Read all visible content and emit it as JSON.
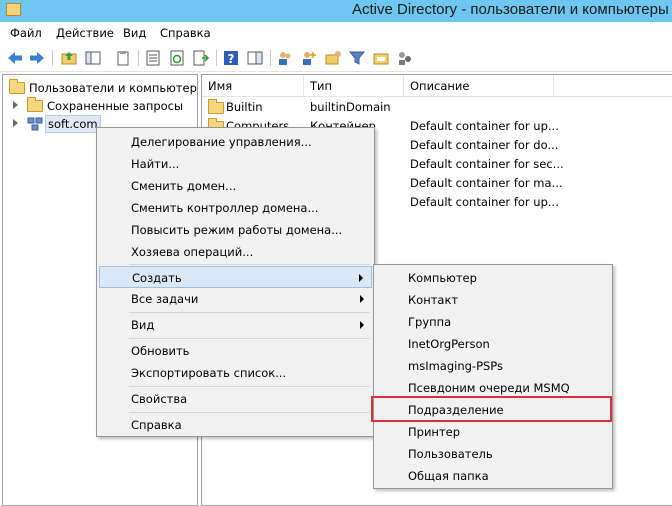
{
  "window": {
    "title": "Active Directory - пользователи и компьютеры"
  },
  "menubar": {
    "items": [
      "Файл",
      "Действие",
      "Вид",
      "Справка"
    ]
  },
  "toolbar": {
    "icons": [
      "back-arrow-icon",
      "forward-arrow-icon",
      "up-folder-icon",
      "console-tree-icon",
      "clipboard-icon",
      "properties-icon",
      "refresh-icon",
      "export-list-icon",
      "help-icon",
      "action-pane-icon",
      "users-icon",
      "add-user-icon",
      "add-group-icon",
      "filter-icon",
      "new-folder-icon",
      "delegate-icon"
    ]
  },
  "tree": {
    "root": "Пользователи и компьютеры А",
    "saved_queries": "Сохраненные запросы",
    "domain": "soft.com"
  },
  "list": {
    "columns": [
      "Имя",
      "Тип",
      "Описание"
    ],
    "rows": [
      {
        "name": "Builtin",
        "type": "builtinDomain",
        "description": ""
      },
      {
        "name": "Computers",
        "type": "Контейнер",
        "description": "Default container for up..."
      },
      {
        "name": "",
        "type": "",
        "description": "Default container for do..."
      },
      {
        "name": "",
        "type": "",
        "description": "Default container for sec..."
      },
      {
        "name": "",
        "type": "",
        "description": "Default container for ma..."
      },
      {
        "name": "",
        "type": "",
        "description": "Default container for up..."
      }
    ]
  },
  "context_menu": {
    "delegate": "Делегирование управления...",
    "find": "Найти...",
    "change_domain": "Сменить домен...",
    "change_dc": "Сменить контроллер домена...",
    "raise_level": "Повысить режим работы домена...",
    "operations_masters": "Хозяева операций...",
    "new": "Создать",
    "all_tasks": "Все задачи",
    "view": "Вид",
    "refresh": "Обновить",
    "export": "Экспортировать список...",
    "properties": "Свойства",
    "help": "Справка"
  },
  "submenu": {
    "items": [
      "Компьютер",
      "Контакт",
      "Группа",
      "InetOrgPerson",
      "msImaging-PSPs",
      "Псевдоним очереди MSMQ",
      "Подразделение",
      "Принтер",
      "Пользователь",
      "Общая папка"
    ]
  }
}
